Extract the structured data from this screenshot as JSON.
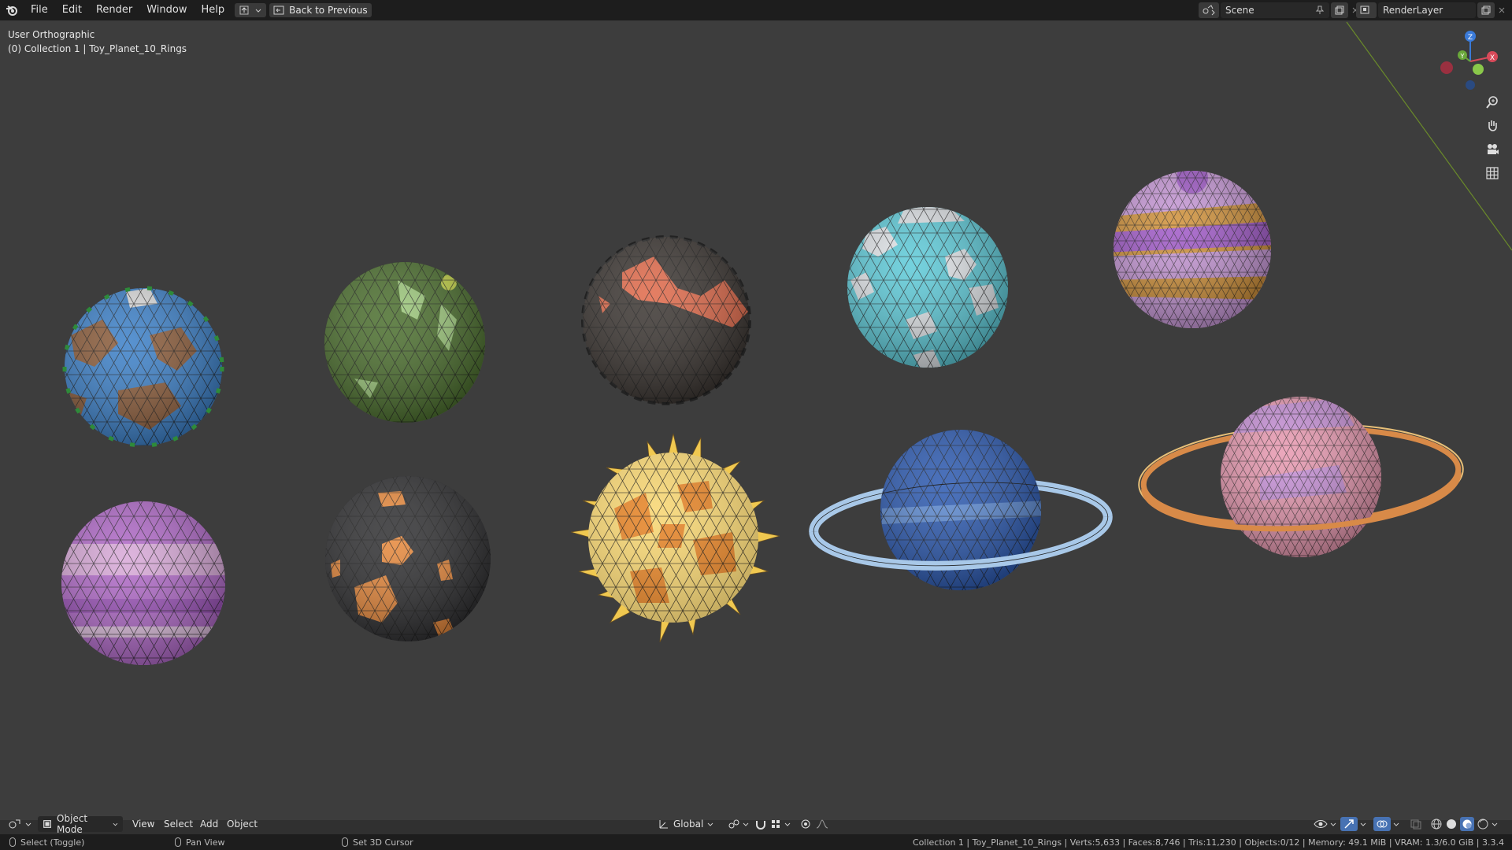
{
  "topbar": {
    "menus": [
      "File",
      "Edit",
      "Render",
      "Window",
      "Help"
    ],
    "back_button": "Back to Previous",
    "scene_label": "Scene",
    "renderlayer_label": "RenderLayer"
  },
  "viewport": {
    "view_name": "User Orthographic",
    "collection_line": "(0) Collection 1 | Toy_Planet_10_Rings",
    "gizmo": {
      "z": "Z",
      "y": "Y",
      "x": "X"
    }
  },
  "planets": [
    {
      "name": "earth-planet",
      "base": "#3a7fc8",
      "accent": "#8a5a38",
      "accent2": "#3aa84a"
    },
    {
      "name": "green-planet",
      "base": "#4a6e2c",
      "accent": "#9cc87a"
    },
    {
      "name": "lava-planet",
      "base": "#3a3430",
      "accent": "#e06848"
    },
    {
      "name": "ice-planet",
      "base": "#5ccad8",
      "accent": "#e0e4e8"
    },
    {
      "name": "banded-purple-planet",
      "base": "#c898d8",
      "accent": "#d09038",
      "accent2": "#a058c8"
    },
    {
      "name": "striped-purple-planet",
      "base": "#b068c8",
      "accent": "#d8a8d8"
    },
    {
      "name": "dark-hex-planet",
      "base": "#2e2e30",
      "accent": "#e8883a"
    },
    {
      "name": "sun-star",
      "base": "#f8d878",
      "accent": "#e88a30"
    },
    {
      "name": "blue-ringed-planet",
      "base": "#2a58b0",
      "ring": "#a8c8e8"
    },
    {
      "name": "pink-ringed-planet",
      "base": "#e898b0",
      "accent": "#c890d8",
      "ring": "#d88a48"
    }
  ],
  "bottombar": {
    "mode": "Object Mode",
    "menus": [
      "View",
      "Select",
      "Add",
      "Object"
    ],
    "orientation": "Global"
  },
  "statusbar": {
    "left": "Select (Toggle)",
    "middle": "Pan View",
    "right_action": "Set 3D Cursor",
    "stats": "Collection 1 | Toy_Planet_10_Rings | Verts:5,633 | Faces:8,746 | Tris:11,230 | Objects:0/12 | Memory: 49.1 MiB | VRAM: 1.3/6.0 GiB | 3.3.4"
  }
}
